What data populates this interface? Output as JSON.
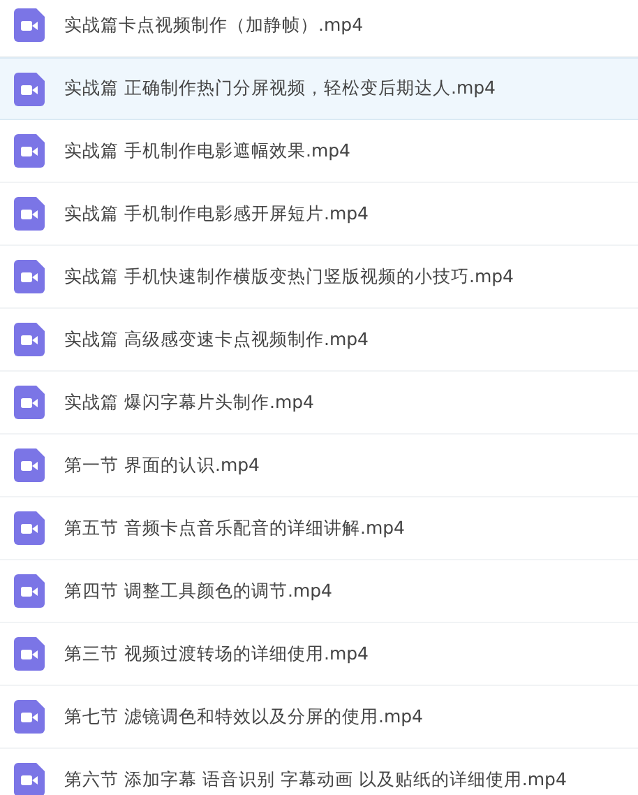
{
  "files": [
    {
      "name": "实战篇卡点视频制作（加静帧）.mp4",
      "selected": false
    },
    {
      "name": "实战篇 正确制作热门分屏视频，轻松变后期达人.mp4",
      "selected": true
    },
    {
      "name": "实战篇 手机制作电影遮幅效果.mp4",
      "selected": false
    },
    {
      "name": "实战篇 手机制作电影感开屏短片.mp4",
      "selected": false
    },
    {
      "name": "实战篇 手机快速制作横版变热门竖版视频的小技巧.mp4",
      "selected": false
    },
    {
      "name": "实战篇 高级感变速卡点视频制作.mp4",
      "selected": false
    },
    {
      "name": "实战篇 爆闪字幕片头制作.mp4",
      "selected": false
    },
    {
      "name": "第一节 界面的认识.mp4",
      "selected": false
    },
    {
      "name": "第五节 音频卡点音乐配音的详细讲解.mp4",
      "selected": false
    },
    {
      "name": "第四节 调整工具颜色的调节.mp4",
      "selected": false
    },
    {
      "name": "第三节 视频过渡转场的详细使用.mp4",
      "selected": false
    },
    {
      "name": "第七节 滤镜调色和特效以及分屏的使用.mp4",
      "selected": false
    },
    {
      "name": "第六节 添加字幕 语音识别 字幕动画 以及贴纸的详细使用.mp4",
      "selected": false
    }
  ]
}
